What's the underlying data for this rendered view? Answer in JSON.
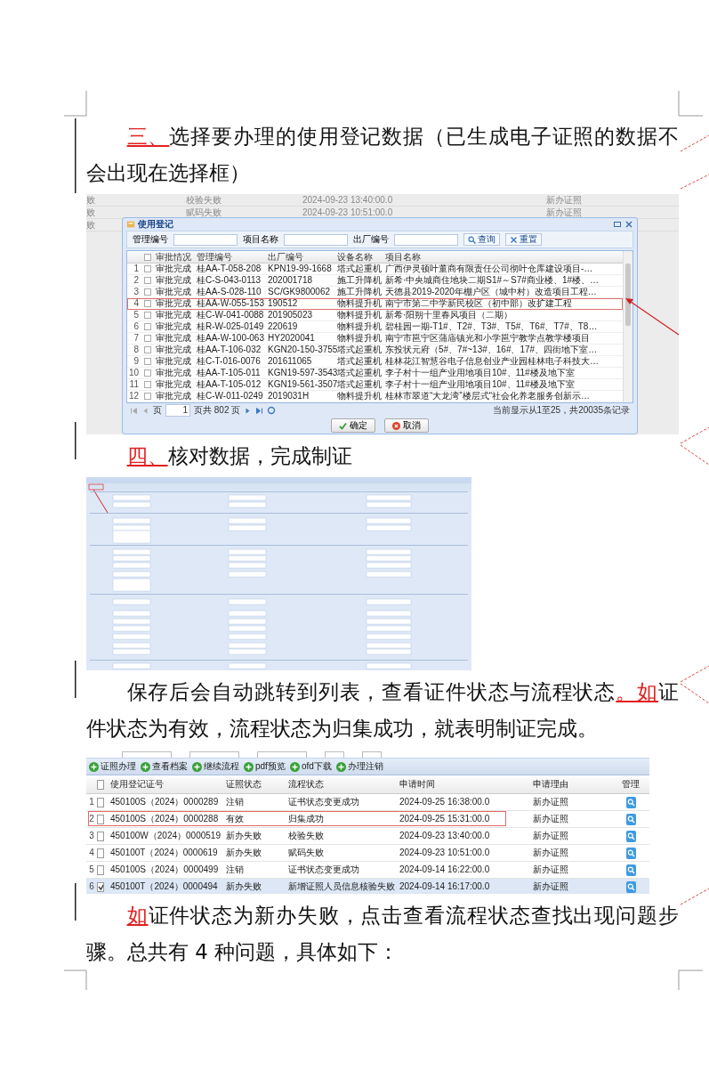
{
  "blocks": [
    {
      "kind": "heading",
      "segments": [
        {
          "text": "三、",
          "revised": true
        },
        {
          "text": "选择要办理的使用登记数据（已生成电子证照的数据不会出现在选择框）",
          "revised": false
        }
      ]
    },
    {
      "kind": "dialog_screenshot",
      "background_rows": [
        {
          "column_1": "败",
          "status": "校验失败",
          "time": "2024-09-23 13:40:00.0",
          "reason": "新办证照"
        },
        {
          "column_1": "败",
          "status": "赋码失败",
          "time": "2024-09-23 10:51:00.0",
          "reason": "新办证照"
        },
        {
          "column_1": "败"
        }
      ],
      "dialog": {
        "title": "使用登记",
        "search_labels": [
          "管理编号",
          "项目名称",
          "出厂编号"
        ],
        "search_buttons": [
          "查询",
          "重置"
        ],
        "header_checked": false,
        "columns": [
          "审批情况",
          "管理编号",
          "出厂编号",
          "设备名称",
          "项目名称"
        ],
        "rows": [
          {
            "number": "1",
            "checked": false,
            "marked": false,
            "cells": [
              "审批完成",
              "桂AA-T-058-208",
              "KPN19-99-1668",
              "塔式起重机",
              "广西伊灵顿叶董商有限责任公司彻叶仓库建设项目-…"
            ]
          },
          {
            "number": "2",
            "checked": false,
            "marked": false,
            "cells": [
              "审批完成",
              "桂C-S-043-0113",
              "202001718",
              "施工升降机",
              "新希·中央城商住地块二期S1#～S7#商业楼、1#楼、…"
            ]
          },
          {
            "number": "3",
            "checked": false,
            "marked": false,
            "cells": [
              "审批完成",
              "桂AA-S-028-110",
              "SC/GK9800062",
              "施工升降机",
              "天德县2019-2020年棚户区（城中村）改造项目工程…"
            ]
          },
          {
            "number": "4",
            "checked": false,
            "marked": true,
            "cells": [
              "审批完成",
              "桂AA-W-055-153",
              "190512",
              "物料提升机",
              "南宁市第二中学新民校区（初中部）改扩建工程"
            ]
          },
          {
            "number": "5",
            "checked": false,
            "marked": false,
            "cells": [
              "审批完成",
              "桂C-W-041-0088",
              "201905023",
              "物料提升机",
              "新希·阳朔十里春风项目（二期）"
            ]
          },
          {
            "number": "6",
            "checked": false,
            "marked": false,
            "cells": [
              "审批完成",
              "桂R-W-025-0149",
              "220619",
              "物料提升机",
              "碧桂园一期-T1#、T2#、T3#、T5#、T6#、T7#、T8…"
            ]
          },
          {
            "number": "7",
            "checked": false,
            "marked": false,
            "cells": [
              "审批完成",
              "桂AA-W-100-063",
              "HY2020041",
              "物料提升机",
              "南宁市邕宁区蒲庙镇光和小学邕宁教学点教学楼项目"
            ]
          },
          {
            "number": "8",
            "checked": false,
            "marked": false,
            "cells": [
              "审批完成",
              "桂AA-T-106-032",
              "KGN20-150-3755",
              "塔式起重机",
              "东投状元府（5#、7#~13#、16#、17#、四街地下室…"
            ]
          },
          {
            "number": "9",
            "checked": false,
            "marked": false,
            "cells": [
              "审批完成",
              "桂C-T-016-0076",
              "201611065",
              "塔式起重机",
              "桂林花江智慧谷电子信息创业产业园桂林电子科技大…"
            ]
          },
          {
            "number": "10",
            "checked": false,
            "marked": false,
            "cells": [
              "审批完成",
              "桂AA-T-105-011",
              "KGN19-597-3543",
              "塔式起重机",
              "李子村十一组产业用地项目10#、11#楼及地下室"
            ]
          },
          {
            "number": "11",
            "checked": false,
            "marked": false,
            "cells": [
              "审批完成",
              "桂AA-T-105-012",
              "KGN19-561-3507",
              "塔式起重机",
              "李子村十一组产业用地项目10#、11#楼及地下室"
            ]
          },
          {
            "number": "12",
            "checked": false,
            "marked": false,
            "cells": [
              "审批完成",
              "桂C-W-011-0249",
              "2019031H",
              "物料提升机",
              "桂林市翠道“大龙湾”楼层式“社会化养老服务创新示…"
            ]
          }
        ],
        "pager": {
          "page_label": "页",
          "page": "1",
          "total": "页共 802 页",
          "summary": "当前显示从1至25，共20035条记录"
        },
        "buttons": [
          "确定",
          "取消"
        ]
      }
    },
    {
      "kind": "heading",
      "segments": [
        {
          "text": "四、",
          "revised": true
        },
        {
          "text": "核对数据，完成制证",
          "revised": false
        }
      ]
    },
    {
      "kind": "form_screenshot"
    },
    {
      "kind": "paragraph",
      "segments": [
        {
          "text": "保存后会自动跳转到列表，查看证件状态与流程状态",
          "revised": false
        },
        {
          "text": "。如",
          "revised": true
        },
        {
          "text": "证件状态为有效，流程状态为归集成功，就表明制证完成。",
          "revised": false
        }
      ]
    },
    {
      "kind": "list_screenshot",
      "toolbar": [
        "证照办理",
        "查看档案",
        "继续流程",
        "pdf预览",
        "ofd下载",
        "办理注销"
      ],
      "header_checked": false,
      "columns": [
        "使用登记证号",
        "证照状态",
        "流程状态",
        "申请时间",
        "申请理由",
        "管理"
      ],
      "rows": [
        {
          "number": "1",
          "checked": false,
          "selected": false,
          "marked": false,
          "cells": [
            "450100S（2024）0000289",
            "注销",
            "证书状态变更成功",
            "2024-09-25 16:38:00.0",
            "新办证照"
          ]
        },
        {
          "number": "2",
          "checked": false,
          "selected": false,
          "marked": true,
          "cells": [
            "450100S（2024）0000288",
            "有效",
            "归集成功",
            "2024-09-25 15:31:00.0",
            "新办证照"
          ]
        },
        {
          "number": "3",
          "checked": false,
          "selected": false,
          "marked": false,
          "cells": [
            "450100W（2024）0000519",
            "新办失败",
            "校验失败",
            "2024-09-23 13:40:00.0",
            "新办证照"
          ]
        },
        {
          "number": "4",
          "checked": false,
          "selected": false,
          "marked": false,
          "cells": [
            "450100T（2024）0000619",
            "新办失败",
            "赋码失败",
            "2024-09-23 10:51:00.0",
            "新办证照"
          ]
        },
        {
          "number": "5",
          "checked": false,
          "selected": false,
          "marked": false,
          "cells": [
            "450100S（2024）0000499",
            "注销",
            "证书状态变更成功",
            "2024-09-14 16:22:00.0",
            "新办证照"
          ]
        },
        {
          "number": "6",
          "checked": true,
          "selected": true,
          "marked": false,
          "cells": [
            "450100T（2024）0000494",
            "新办失败",
            "新增证照人员信息核验失败",
            "2024-09-14 16:17:00.0",
            "新办证照"
          ]
        }
      ]
    },
    {
      "kind": "paragraph",
      "segments": [
        {
          "text": "如",
          "revised": true
        },
        {
          "text": "证件状态为新办失败，点击查看流程状态查找出现问题步骤。总共有 4 种问题，具体如下：",
          "revised": false
        }
      ]
    }
  ]
}
